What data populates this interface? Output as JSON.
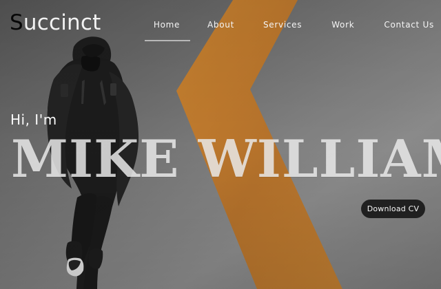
{
  "brand": {
    "initial": "S",
    "rest": "uccinct"
  },
  "nav": {
    "items": [
      {
        "label": "Home",
        "active": true
      },
      {
        "label": "About",
        "active": false
      },
      {
        "label": "Services",
        "active": false
      },
      {
        "label": "Work",
        "active": false
      },
      {
        "label": "Contact Us",
        "active": false
      }
    ]
  },
  "hero": {
    "greeting": "Hi, I'm",
    "name": "MIKE WILLIAMS",
    "cta_label": "Download CV"
  },
  "colors": {
    "accent_stripe": "#d58b2f",
    "button": "#202020",
    "text": "#f5f5f5"
  },
  "icons": {
    "hero_graphic": "person-illustration"
  }
}
